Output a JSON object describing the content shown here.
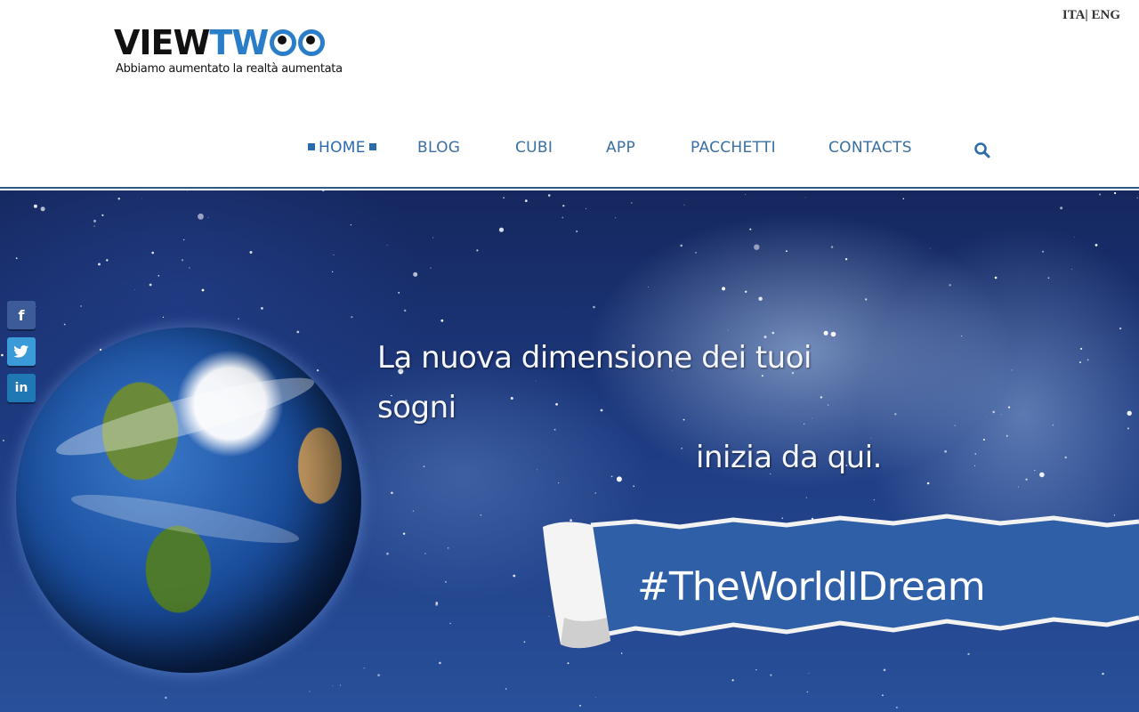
{
  "header": {
    "logo": {
      "word_view": "VIEW",
      "word_two": "TWOO",
      "tagline": "Abbiamo aumentato la realtà aumentata"
    },
    "language": {
      "ita": "ITA",
      "separator": "|",
      "eng": "ENG"
    }
  },
  "nav": {
    "items": [
      {
        "label": "HOME",
        "active": true
      },
      {
        "label": "BLOG",
        "active": false
      },
      {
        "label": "CUBI",
        "active": false
      },
      {
        "label": "APP",
        "active": false
      },
      {
        "label": "PACCHETTI",
        "active": false
      },
      {
        "label": "CONTACTS",
        "active": false
      }
    ],
    "search_icon": "search-icon"
  },
  "hero": {
    "headline_line1": "La nuova dimensione dei tuoi sogni",
    "headline_line2": "inizia da qui.",
    "hashtag": "#TheWorldIDream"
  },
  "social": [
    {
      "icon": "facebook-icon",
      "glyph": "f",
      "color": "#3d5a99"
    },
    {
      "icon": "twitter-icon",
      "glyph": "t",
      "color": "#3b9ad8"
    },
    {
      "icon": "linkedin-icon",
      "glyph": "in",
      "color": "#1f78b4"
    }
  ],
  "colors": {
    "accent": "#2a6bb0",
    "banner": "#2f5fa6",
    "rule": "#2c5a86"
  }
}
